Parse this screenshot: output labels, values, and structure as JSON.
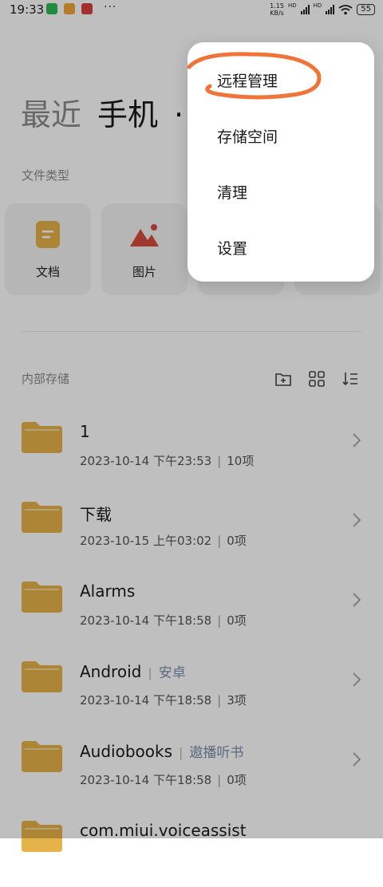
{
  "status_bar": {
    "time": "19:33",
    "speed_value": "1.15",
    "speed_unit": "KB/s",
    "hd1": "HD",
    "hd2": "HD",
    "battery": "55"
  },
  "tabs": [
    "最近",
    "手机",
    "·"
  ],
  "file_types": {
    "title": "文件类型",
    "items": [
      {
        "label": "文档",
        "icon": "document-icon"
      },
      {
        "label": "图片",
        "icon": "image-icon"
      }
    ]
  },
  "storage": {
    "title": "内部存储",
    "tools": [
      "new-folder-icon",
      "grid-view-icon",
      "sort-icon"
    ]
  },
  "folders": [
    {
      "name": "1",
      "alias": "",
      "date": "2023-10-14 下午23:53",
      "count": "10项"
    },
    {
      "name": "下载",
      "alias": "",
      "date": "2023-10-15 上午03:02",
      "count": "0项"
    },
    {
      "name": "Alarms",
      "alias": "",
      "date": "2023-10-14 下午18:58",
      "count": "0项"
    },
    {
      "name": "Android",
      "alias": "安卓",
      "date": "2023-10-14 下午18:58",
      "count": "3项"
    },
    {
      "name": "Audiobooks",
      "alias": "遨播听书",
      "date": "2023-10-14 下午18:58",
      "count": "0项"
    },
    {
      "name": "com.miui.voiceassist",
      "alias": "",
      "date": "",
      "count": ""
    }
  ],
  "menu": {
    "items": [
      "远程管理",
      "存储空间",
      "清理",
      "设置"
    ]
  },
  "colors": {
    "folder": "#E6B24A",
    "annotation": "#F0743A",
    "alias": "#7A8EAA"
  }
}
